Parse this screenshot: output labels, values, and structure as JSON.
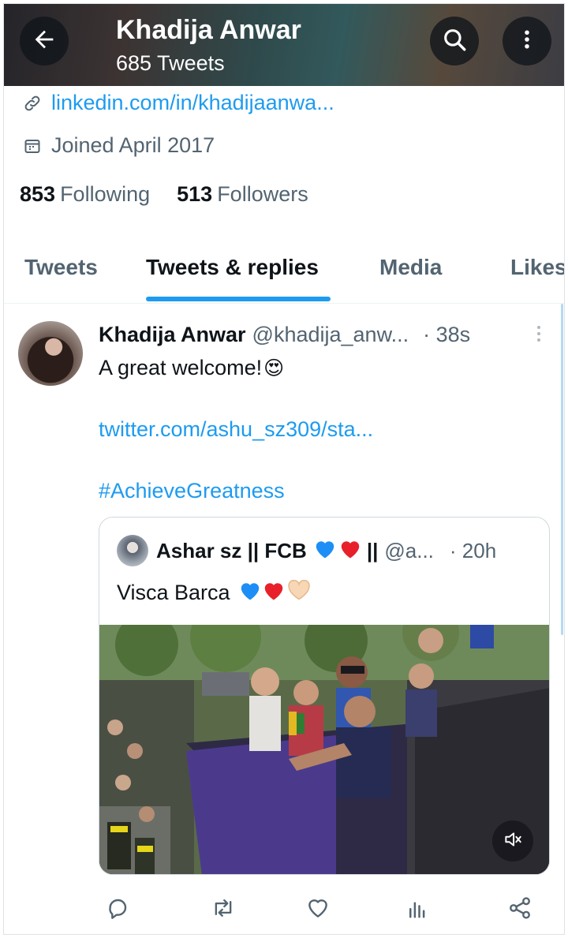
{
  "header": {
    "name": "Khadija Anwar",
    "tweet_count": "685 Tweets",
    "back_icon": "arrow-left-icon",
    "search_icon": "search-icon",
    "more_icon": "more-vertical-icon"
  },
  "profile": {
    "website": "linkedin.com/in/khadijaanwa...",
    "joined": "Joined April 2017",
    "following_count": "853",
    "following_label": "Following",
    "followers_count": "513",
    "followers_label": "Followers"
  },
  "tabs": [
    {
      "label": "Tweets",
      "active": false
    },
    {
      "label": "Tweets & replies",
      "active": true
    },
    {
      "label": "Media",
      "active": false
    },
    {
      "label": "Likes",
      "active": false
    }
  ],
  "tweet": {
    "author_name": "Khadija Anwar",
    "author_handle": "@khadija_anw...",
    "time": "· 38s",
    "text": "A great welcome!",
    "emoji": "😍",
    "link": "twitter.com/ashu_sz309/sta...",
    "hashtag": "#AchieveGreatness",
    "quote": {
      "author_name_prefix": "Ashar sz || FCB",
      "author_name_suffix": "||",
      "author_handle": "@a...",
      "time": "· 20h",
      "text": "Visca Barca",
      "media_icon": "volume-mute-icon"
    }
  },
  "colors": {
    "accent": "#1d9bf0",
    "text_primary": "#0f1419",
    "text_secondary": "#536471",
    "blue_heart": "#1d8ef5",
    "red_heart": "#e8202a"
  },
  "actions": [
    "reply-icon",
    "retweet-icon",
    "like-icon",
    "analytics-icon",
    "share-icon"
  ]
}
